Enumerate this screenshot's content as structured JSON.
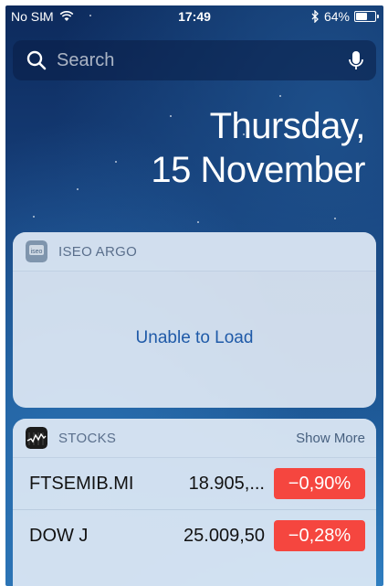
{
  "status_bar": {
    "carrier": "No SIM",
    "time": "17:49",
    "battery": "64%",
    "battery_level": 0.64,
    "icons": [
      "wifi-icon",
      "bluetooth-icon",
      "battery-icon"
    ]
  },
  "search": {
    "placeholder": "Search",
    "icons": [
      "search-icon",
      "microphone-icon"
    ]
  },
  "date": {
    "weekday": "Thursday,",
    "day_month": "15 November"
  },
  "iseo_widget": {
    "title": "ISEO ARGO",
    "message": "Unable to Load",
    "icon": "iseo-app-icon"
  },
  "stocks_widget": {
    "title": "STOCKS",
    "show_more": "Show More",
    "icon": "stocks-app-icon",
    "rows": [
      {
        "symbol": "FTSEMIB.MI",
        "price": "18.905,...",
        "change": "−0,90%"
      },
      {
        "symbol": "DOW J",
        "price": "25.009,50",
        "change": "−0,28%"
      }
    ]
  },
  "colors": {
    "negative_change": "#f5463f",
    "link_blue": "#1f5aa8",
    "widget_title": "#5a6f8c"
  }
}
